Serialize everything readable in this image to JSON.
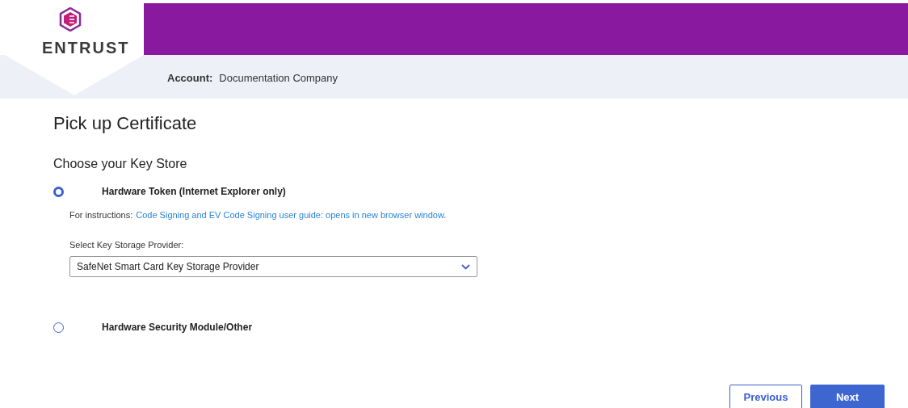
{
  "header": {
    "logo_text": "ENTRUST",
    "account_label": "Account:",
    "account_name": "Documentation Company"
  },
  "page_title": "Pick up Certificate",
  "section_title": "Choose your Key Store",
  "options": [
    {
      "label": "Hardware Token (Internet Explorer only)",
      "selected": true,
      "instructions_prefix": "For instructions:",
      "instructions_link": "Code Signing and EV Code Signing user guide: opens in new browser window.",
      "select_label": "Select Key Storage Provider:",
      "select_value": "SafeNet Smart Card Key Storage Provider"
    },
    {
      "label": "Hardware Security Module/Other",
      "selected": false
    }
  ],
  "buttons": [
    {
      "label": "Previous",
      "kind": "secondary"
    },
    {
      "label": "Next",
      "kind": "primary"
    }
  ]
}
